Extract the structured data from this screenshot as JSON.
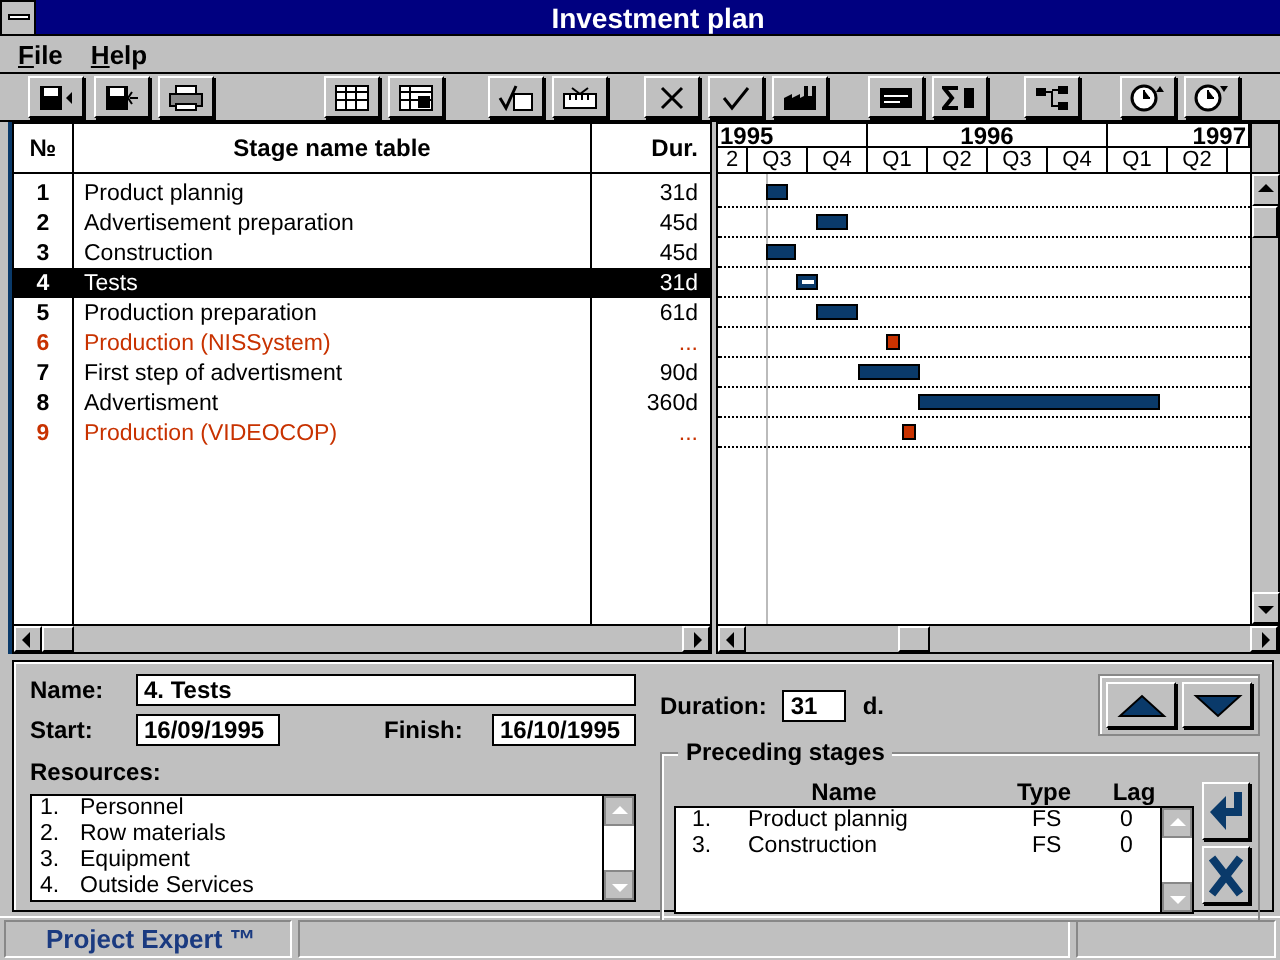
{
  "window": {
    "title": "Investment plan"
  },
  "menu": [
    {
      "label": "File"
    },
    {
      "label": "Help"
    }
  ],
  "table": {
    "columns": [
      "№",
      "Stage name table",
      "Dur."
    ],
    "rows": [
      {
        "number": "1",
        "name": "Product plannig",
        "duration": "31d",
        "kind": "task",
        "selected": false
      },
      {
        "number": "2",
        "name": "Advertisement preparation",
        "duration": "45d",
        "kind": "task",
        "selected": false
      },
      {
        "number": "3",
        "name": "Construction",
        "duration": "45d",
        "kind": "task",
        "selected": false
      },
      {
        "number": "4",
        "name": "Tests",
        "duration": "31d",
        "kind": "task",
        "selected": true
      },
      {
        "number": "5",
        "name": "Production preparation",
        "duration": "61d",
        "kind": "task",
        "selected": false
      },
      {
        "number": "6",
        "name": "Production  (NISSystem)",
        "duration": "...",
        "kind": "external",
        "selected": false
      },
      {
        "number": "7",
        "name": "First step of advertisment",
        "duration": "90d",
        "kind": "task",
        "selected": false
      },
      {
        "number": "8",
        "name": "Advertisment",
        "duration": "360d",
        "kind": "task",
        "selected": false
      },
      {
        "number": "9",
        "name": "Production  (VIDEOCOP)",
        "duration": "...",
        "kind": "external",
        "selected": false
      }
    ]
  },
  "gantt": {
    "years": [
      "1995",
      "1996",
      "1997"
    ],
    "quarters": [
      "2",
      "Q3",
      "Q4",
      "Q1",
      "Q2",
      "Q3",
      "Q4",
      "Q1",
      "Q2"
    ]
  },
  "details": {
    "name_label": "Name:",
    "name": "4. Tests",
    "start_label": "Start:",
    "start": "16/09/1995",
    "finish_label": "Finish:",
    "finish": "16/10/1995",
    "duration_label": "Duration:",
    "duration": "31",
    "duration_unit": "d.",
    "resources_label": "Resources:",
    "resources": [
      {
        "number": "1.",
        "name": "Personnel"
      },
      {
        "number": "2.",
        "name": "Row materials"
      },
      {
        "number": "3.",
        "name": "Equipment"
      },
      {
        "number": "4.",
        "name": "Outside Services"
      }
    ]
  },
  "preceding": {
    "title": "Preceding stages",
    "columns": [
      "Name",
      "Type",
      "Lag"
    ],
    "rows": [
      {
        "number": "1.",
        "name": "Product plannig",
        "type": "FS",
        "lag": "0"
      },
      {
        "number": "3.",
        "name": "Construction",
        "type": "FS",
        "lag": "0"
      }
    ]
  },
  "status_bar": {
    "app": "Project Expert ™"
  }
}
